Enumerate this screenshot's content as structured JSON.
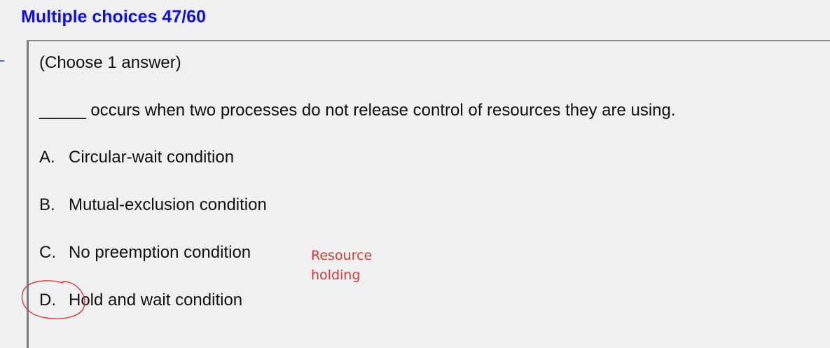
{
  "header": {
    "title": "Multiple choices 47/60"
  },
  "question": {
    "instruction": "(Choose 1 answer)",
    "text": "_____ occurs when two processes do not release control of resources they are using.",
    "options": [
      {
        "letter": "A.",
        "text": "Circular-wait condition"
      },
      {
        "letter": "B.",
        "text": "Mutual-exclusion condition"
      },
      {
        "letter": "C.",
        "text": "No preemption condition"
      },
      {
        "letter": "D.",
        "text": "Hold and wait condition"
      }
    ]
  },
  "annotation": {
    "note_lines": [
      "Resource",
      "holding"
    ],
    "circled_option": "D.",
    "color": "#d63a3a"
  },
  "colors": {
    "title": "#1010e0",
    "background": "#f0f0f0",
    "text": "#111111"
  }
}
